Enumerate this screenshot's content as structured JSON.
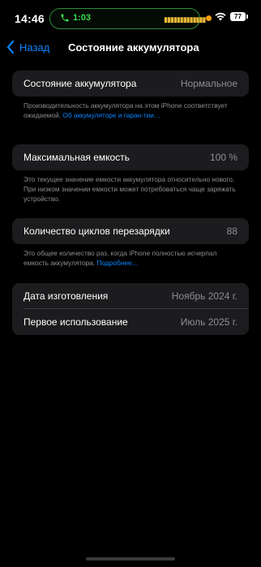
{
  "status_bar": {
    "time": "14:46",
    "call_duration": "1:03",
    "call_color": "#3adb4e",
    "battery_level": "77"
  },
  "nav": {
    "back_label": "Назад",
    "title": "Состояние аккумулятора"
  },
  "battery_condition": {
    "label": "Состояние аккумулятора",
    "value": "Нормальное",
    "footer_text": "Производительность аккумулятора на этом iPhone соответствует ожидаемой.",
    "footer_link": "Об аккумуляторе и гаран-тии…"
  },
  "max_capacity": {
    "label": "Максимальная емкость",
    "value": "100 %",
    "footer_text": "Это текущее значение емкости аккумулятора относительно нового. При низком значении емкости может потребоваться чаще заряжать устройство."
  },
  "cycle_count": {
    "label": "Количество циклов перезарядки",
    "value": "88",
    "footer_text": "Это общее количество раз, когда iPhone полностью исчерпал емкость аккумулятора.",
    "footer_link": "Подробнее…"
  },
  "dates": {
    "manufacture_label": "Дата изготовления",
    "manufacture_value": "Ноябрь 2024 г.",
    "first_use_label": "Первое использование",
    "first_use_value": "Июль 2025 г."
  },
  "colors": {
    "accent": "#0a84ff",
    "background": "#000000",
    "card": "#1c1c1e",
    "secondary_text": "#8e8e93"
  }
}
